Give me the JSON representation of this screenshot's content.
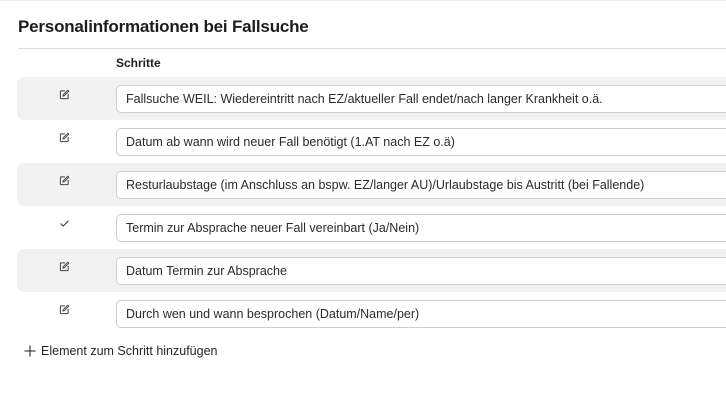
{
  "title": "Personalinformationen bei Fallsuche",
  "column_header": "Schritte",
  "rows": [
    {
      "icon": "edit-icon",
      "text": "Fallsuche WEIL: Wiedereintritt nach EZ/aktueller Fall endet/nach langer Krankheit o.ä."
    },
    {
      "icon": "edit-icon",
      "text": "Datum ab wann wird neuer Fall benötigt (1.AT nach EZ o.ä)"
    },
    {
      "icon": "edit-icon",
      "text": "Resturlaubstage (im Anschluss an bspw. EZ/langer AU)/Urlaubstage bis Austritt (bei Fallende)"
    },
    {
      "icon": "check-icon",
      "text": "Termin zur Absprache neuer Fall vereinbart (Ja/Nein)"
    },
    {
      "icon": "edit-icon",
      "text": "Datum Termin zur Absprache"
    },
    {
      "icon": "edit-icon",
      "text": "Durch wen und wann besprochen (Datum/Name/per)"
    }
  ],
  "add_step_label": "Element zum Schritt hinzufügen"
}
